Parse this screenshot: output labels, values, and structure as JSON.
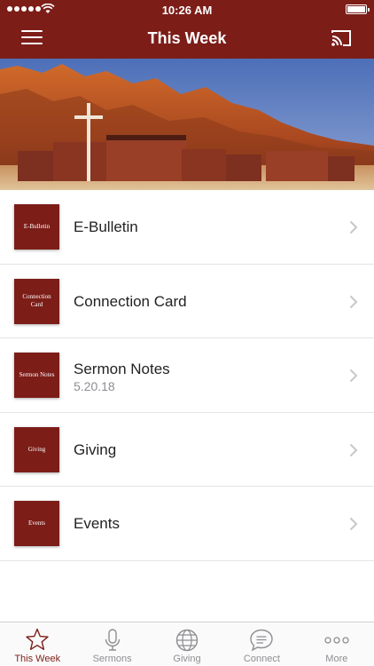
{
  "status_bar": {
    "time": "10:26 AM"
  },
  "header": {
    "title": "This Week"
  },
  "hero": {
    "alt": "church building with mountains"
  },
  "items": [
    {
      "thumb": "E-Bulletin",
      "title": "E-Bulletin",
      "subtitle": ""
    },
    {
      "thumb": "Connection Card",
      "title": "Connection Card",
      "subtitle": ""
    },
    {
      "thumb": "Sermon Notes",
      "title": "Sermon Notes",
      "subtitle": "5.20.18"
    },
    {
      "thumb": "Giving",
      "title": "Giving",
      "subtitle": ""
    },
    {
      "thumb": "Events",
      "title": "Events",
      "subtitle": ""
    }
  ],
  "tabs": [
    {
      "label": "This Week",
      "icon": "star-icon",
      "active": true
    },
    {
      "label": "Sermons",
      "icon": "microphone-icon",
      "active": false
    },
    {
      "label": "Giving",
      "icon": "globe-icon",
      "active": false
    },
    {
      "label": "Connect",
      "icon": "chat-bubble-icon",
      "active": false
    },
    {
      "label": "More",
      "icon": "more-dots-icon",
      "active": false
    }
  ],
  "colors": {
    "brand": "#7c1d18",
    "active_tab": "#7c1d18",
    "inactive_tab": "#8e8e93"
  }
}
